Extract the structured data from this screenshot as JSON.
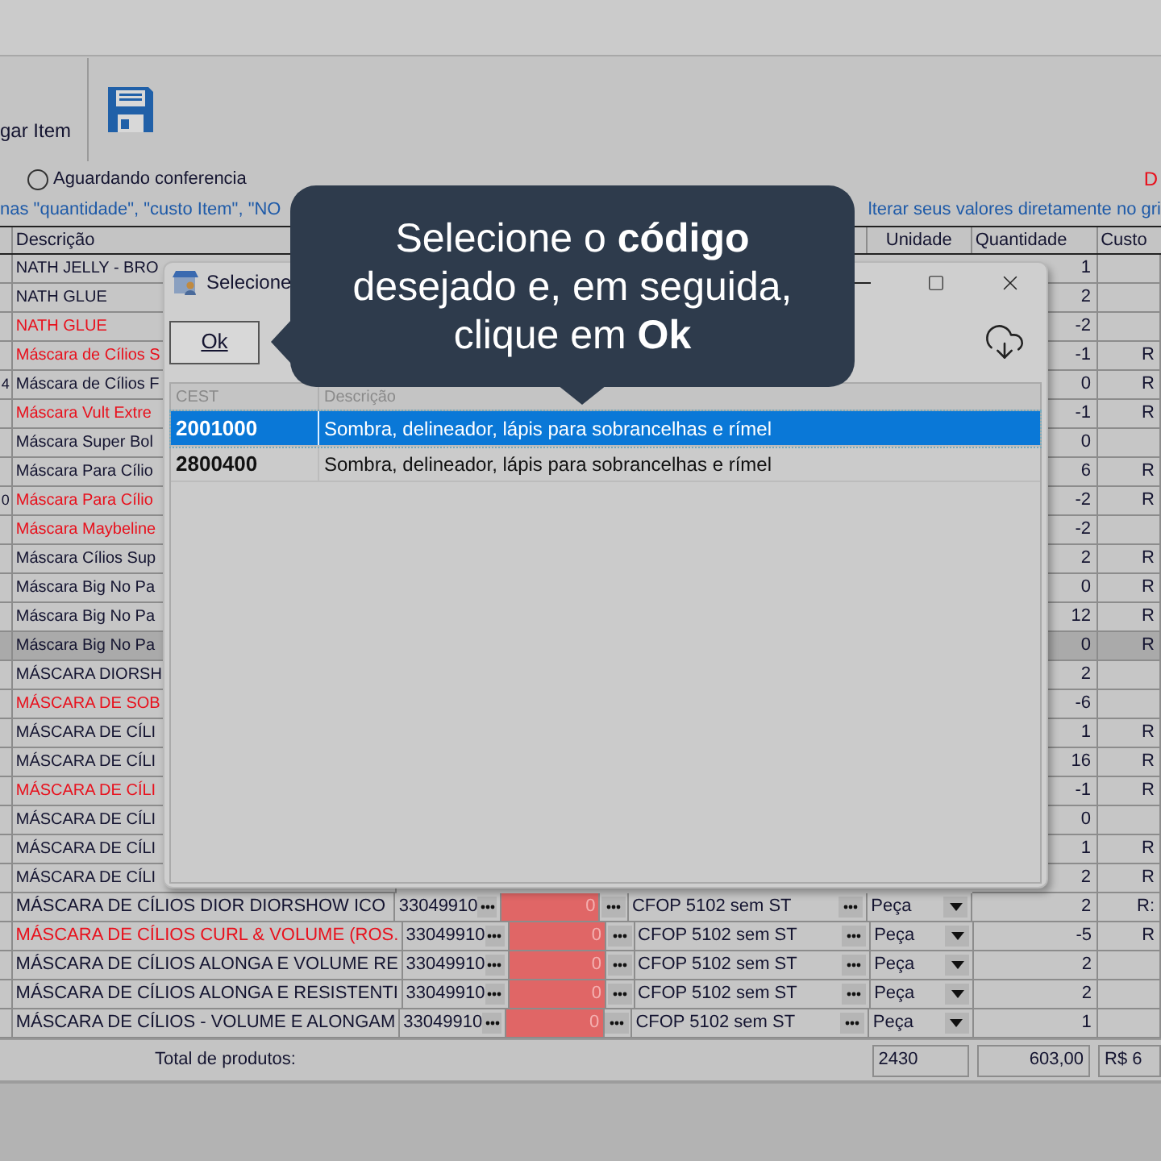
{
  "toolbar": {
    "button_label": "gar Item"
  },
  "filter": {
    "radio": {
      "label": "Aguardando conferencia",
      "checked": false
    },
    "corner_text": "D"
  },
  "hint": {
    "left": "nas \"quantidade\", \"custo Item\", \"NO",
    "right": "lterar seus valores diretamente no gri"
  },
  "table": {
    "columns": [
      "Descrição",
      "Unidade",
      "Quantidade",
      "Custo"
    ],
    "rows": [
      {
        "kind": "covered",
        "description": "NATH JELLY - BRO",
        "red": false,
        "current": false,
        "quantity": "1"
      },
      {
        "kind": "covered",
        "description": "NATH GLUE",
        "red": false,
        "current": false,
        "quantity": "2"
      },
      {
        "kind": "covered",
        "description": "NATH GLUE",
        "red": true,
        "current": false,
        "quantity": "-2"
      },
      {
        "kind": "covered",
        "description": "Máscara de Cílios S",
        "red": true,
        "current": false,
        "quantity": "-1",
        "cost": "R"
      },
      {
        "kind": "covered",
        "index": "4",
        "description": "Máscara de Cílios F",
        "red": false,
        "current": false,
        "quantity": "0",
        "cost": "R"
      },
      {
        "kind": "covered",
        "description": "Máscara Vult Extre",
        "red": true,
        "current": false,
        "quantity": "-1",
        "cost": "R"
      },
      {
        "kind": "covered",
        "description": "Máscara Super Bol",
        "red": false,
        "current": false,
        "quantity": "0"
      },
      {
        "kind": "covered",
        "description": "Máscara Para Cílio",
        "red": false,
        "current": false,
        "quantity": "6",
        "cost": "R"
      },
      {
        "kind": "covered",
        "index": "0",
        "description": "Máscara Para Cílio",
        "red": true,
        "current": false,
        "quantity": "-2",
        "cost": "R"
      },
      {
        "kind": "covered",
        "description": "Máscara Maybeline",
        "red": true,
        "current": false,
        "quantity": "-2"
      },
      {
        "kind": "covered",
        "description": "Máscara Cílios Sup",
        "red": false,
        "current": false,
        "quantity": "2",
        "cost": "R"
      },
      {
        "kind": "covered",
        "description": "Máscara Big No Pa",
        "red": false,
        "current": false,
        "quantity": "0",
        "cost": "R"
      },
      {
        "kind": "covered",
        "description": "Máscara Big No Pa",
        "red": false,
        "current": false,
        "quantity": "12",
        "cost": "R"
      },
      {
        "kind": "covered",
        "description": "Máscara Big No Pa",
        "red": false,
        "current": true,
        "quantity": "0",
        "cost": "R"
      },
      {
        "kind": "covered",
        "description": "MÁSCARA DIORSH",
        "red": false,
        "current": false,
        "quantity": "2"
      },
      {
        "kind": "covered",
        "description": "MÁSCARA DE SOB",
        "red": true,
        "current": false,
        "quantity": "-6"
      },
      {
        "kind": "covered",
        "description": "MÁSCARA DE CÍLI",
        "red": false,
        "current": false,
        "quantity": "1",
        "cost": "R"
      },
      {
        "kind": "covered",
        "description": "MÁSCARA DE CÍLI",
        "red": false,
        "current": false,
        "quantity": "16",
        "cost": "R"
      },
      {
        "kind": "covered",
        "description": "MÁSCARA DE CÍLI",
        "red": true,
        "current": false,
        "quantity": "-1",
        "cost": "R"
      },
      {
        "kind": "covered",
        "description": "MÁSCARA DE CÍLI",
        "red": false,
        "current": false,
        "quantity": "0"
      },
      {
        "kind": "covered",
        "description": "MÁSCARA DE CÍLI",
        "red": false,
        "current": false,
        "quantity": "1",
        "cost": "R"
      },
      {
        "kind": "covered",
        "description": "MÁSCARA DE CÍLI",
        "red": false,
        "current": false,
        "quantity": "2",
        "cost": "R"
      },
      {
        "kind": "full",
        "description": "MÁSCARA DE CÍLIOS DIOR DIORSHOW ICO",
        "ncm": "33049910",
        "value": "0",
        "cfop": "CFOP 5102 sem ST",
        "unit": "Peça",
        "red": false,
        "current": false,
        "quantity": "2",
        "cost": "R:"
      },
      {
        "kind": "full",
        "description": "MÁSCARA DE CÍLIOS CURL & VOLUME (ROS.",
        "ncm": "33049910",
        "value": "0",
        "cfop": "CFOP 5102 sem ST",
        "unit": "Peça",
        "red": true,
        "current": false,
        "quantity": "-5",
        "cost": "R"
      },
      {
        "kind": "full",
        "description": "MÁSCARA DE CÍLIOS ALONGA E VOLUME RE",
        "ncm": "33049910",
        "value": "0",
        "cfop": "CFOP 5102 sem ST",
        "unit": "Peça",
        "red": false,
        "current": false,
        "quantity": "2"
      },
      {
        "kind": "full",
        "description": "MÁSCARA DE CÍLIOS ALONGA E RESISTENTI",
        "ncm": "33049910",
        "value": "0",
        "cfop": "CFOP 5102 sem ST",
        "unit": "Peça",
        "red": false,
        "current": false,
        "quantity": "2"
      },
      {
        "kind": "full",
        "description": "MÁSCARA DE CÍLIOS - VOLUME E ALONGAM",
        "ncm": "33049910",
        "value": "0",
        "cfop": "CFOP 5102 sem ST",
        "unit": "Peça",
        "red": false,
        "current": false,
        "quantity": "1"
      }
    ]
  },
  "footer": {
    "label": "Total de produtos:",
    "totals": [
      "2430",
      "603,00",
      "R$ 6"
    ]
  },
  "dialog": {
    "title": "Selecione",
    "ok_button": "Ok",
    "grid": {
      "columns": [
        "CEST",
        "Descrição"
      ],
      "rows": [
        {
          "code": "2001000",
          "description": "Sombra, delineador, lápis para sobrancelhas e rímel",
          "selected": true
        },
        {
          "code": "2800400",
          "description": "Sombra, delineador, lápis para sobrancelhas e rímel",
          "selected": false
        }
      ]
    }
  },
  "tooltip": {
    "lines": [
      "Selecione o **código**",
      "desejado e, em seguida,",
      "clique em **Ok**"
    ]
  }
}
